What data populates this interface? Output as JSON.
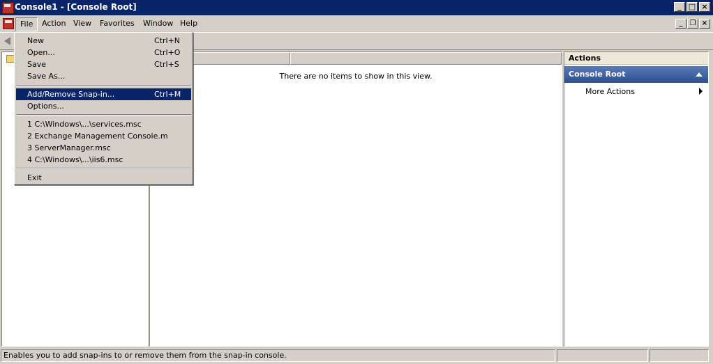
{
  "window": {
    "title": "Console1 - [Console Root]",
    "minimize_label": "_",
    "maximize_label": "□",
    "close_label": "×"
  },
  "menubar": {
    "items": [
      {
        "label": "File"
      },
      {
        "label": "Action"
      },
      {
        "label": "View"
      },
      {
        "label": "Favorites"
      },
      {
        "label": "Window"
      },
      {
        "label": "Help"
      }
    ],
    "mdi_minimize": "_",
    "mdi_restore": "❐",
    "mdi_close": "×"
  },
  "file_menu": {
    "items": [
      {
        "label": "New",
        "shortcut": "Ctrl+N"
      },
      {
        "label": "Open...",
        "shortcut": "Ctrl+O"
      },
      {
        "label": "Save",
        "shortcut": "Ctrl+S"
      },
      {
        "label": "Save As...",
        "shortcut": ""
      },
      {
        "label": "Add/Remove Snap-in...",
        "shortcut": "Ctrl+M",
        "highlighted": true
      },
      {
        "label": "Options...",
        "shortcut": ""
      },
      {
        "label": "1 C:\\Windows\\...\\services.msc",
        "shortcut": ""
      },
      {
        "label": "2 Exchange Management Console.m",
        "shortcut": ""
      },
      {
        "label": "3 ServerManager.msc",
        "shortcut": ""
      },
      {
        "label": "4 C:\\Windows\\...\\iis6.msc",
        "shortcut": ""
      },
      {
        "label": "Exit",
        "shortcut": ""
      }
    ]
  },
  "center": {
    "empty_message": "There are no items to show in this view."
  },
  "actions": {
    "header": "Actions",
    "section_title": "Console Root",
    "more_actions": "More Actions"
  },
  "statusbar": {
    "text": "Enables you to add snap-ins to or remove them from the snap-in console."
  },
  "icons": {
    "app": "mmc-console-icon",
    "back": "back-arrow-icon",
    "folder": "folder-icon"
  },
  "colors": {
    "titlebar": "#0a246a",
    "highlight": "#0a246a",
    "chrome": "#d4d0c8",
    "actions_section": "#2e4f8f"
  }
}
